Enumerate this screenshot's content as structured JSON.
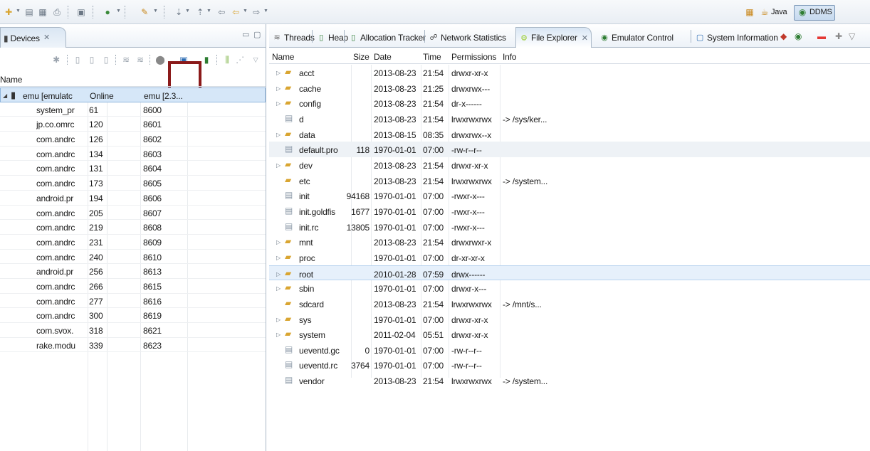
{
  "toolbar": {
    "icons": [
      "new-icon",
      "save-icon",
      "save-all-icon",
      "print-icon",
      "terminal-icon",
      "run-icon",
      "wand-icon",
      "next-annotation-icon",
      "prev-annotation-icon",
      "back-icon",
      "forward-icon",
      "history-icon"
    ],
    "perspectives": [
      {
        "name": "open-perspective-icon",
        "label": ""
      },
      {
        "name": "java-perspective",
        "label": "Java"
      },
      {
        "name": "ddms-perspective",
        "label": "DDMS"
      }
    ]
  },
  "devices": {
    "tab_label": "Devices",
    "tab_close": "✕",
    "column_name": "Name",
    "rows": [
      {
        "name": "emu [emulatc",
        "pid": "Online",
        "port": "emu [2.3...",
        "expanded": true,
        "device": true
      },
      {
        "name": "system_pr",
        "pid": "61",
        "port": "8600"
      },
      {
        "name": "jp.co.omrc",
        "pid": "120",
        "port": "8601"
      },
      {
        "name": "com.andrc",
        "pid": "126",
        "port": "8602"
      },
      {
        "name": "com.andrc",
        "pid": "134",
        "port": "8603"
      },
      {
        "name": "com.andrc",
        "pid": "131",
        "port": "8604"
      },
      {
        "name": "com.andrc",
        "pid": "173",
        "port": "8605"
      },
      {
        "name": "android.pr",
        "pid": "194",
        "port": "8606"
      },
      {
        "name": "com.andrc",
        "pid": "205",
        "port": "8607"
      },
      {
        "name": "com.andrc",
        "pid": "219",
        "port": "8608"
      },
      {
        "name": "com.andrc",
        "pid": "231",
        "port": "8609"
      },
      {
        "name": "com.andrc",
        "pid": "240",
        "port": "8610"
      },
      {
        "name": "android.pr",
        "pid": "256",
        "port": "8613"
      },
      {
        "name": "com.andrc",
        "pid": "266",
        "port": "8615"
      },
      {
        "name": "com.andrc",
        "pid": "277",
        "port": "8616"
      },
      {
        "name": "com.andrc",
        "pid": "300",
        "port": "8619"
      },
      {
        "name": "com.svox.",
        "pid": "318",
        "port": "8621"
      },
      {
        "name": "rake.modu",
        "pid": "339",
        "port": "8623"
      }
    ]
  },
  "views": {
    "tabs": [
      {
        "label": "Threads",
        "icon": "threads-icon",
        "active": false
      },
      {
        "label": "Heap",
        "icon": "heap-icon",
        "active": false
      },
      {
        "label": "Allocation Tracker",
        "icon": "allocation-icon",
        "active": false
      },
      {
        "label": "Network Statistics",
        "icon": "network-icon",
        "active": false
      },
      {
        "label": "File Explorer",
        "icon": "android-icon",
        "active": true
      },
      {
        "label": "Emulator Control",
        "icon": "emulator-icon",
        "active": false
      },
      {
        "label": "System Information",
        "icon": "sysinfo-icon",
        "active": false
      }
    ]
  },
  "file_explorer": {
    "columns": {
      "name": "Name",
      "size": "Size",
      "date": "Date",
      "time": "Time",
      "permissions": "Permissions",
      "info": "Info"
    },
    "rows": [
      {
        "name": "acct",
        "folder": true,
        "expandable": true,
        "size": "",
        "date": "2013-08-23",
        "time": "21:54",
        "perm": "drwxr-xr-x",
        "info": ""
      },
      {
        "name": "cache",
        "folder": true,
        "expandable": true,
        "size": "",
        "date": "2013-08-23",
        "time": "21:25",
        "perm": "drwxrwx---",
        "info": ""
      },
      {
        "name": "config",
        "folder": true,
        "expandable": true,
        "size": "",
        "date": "2013-08-23",
        "time": "21:54",
        "perm": "dr-x------",
        "info": ""
      },
      {
        "name": "d",
        "folder": false,
        "expandable": false,
        "size": "",
        "date": "2013-08-23",
        "time": "21:54",
        "perm": "lrwxrwxrwx",
        "info": "-> /sys/ker..."
      },
      {
        "name": "data",
        "folder": true,
        "expandable": true,
        "size": "",
        "date": "2013-08-15",
        "time": "08:35",
        "perm": "drwxrwx--x",
        "info": ""
      },
      {
        "name": "default.pro",
        "folder": false,
        "expandable": false,
        "size": "118",
        "date": "1970-01-01",
        "time": "07:00",
        "perm": "-rw-r--r--",
        "info": ""
      },
      {
        "name": "dev",
        "folder": true,
        "expandable": true,
        "size": "",
        "date": "2013-08-23",
        "time": "21:54",
        "perm": "drwxr-xr-x",
        "info": ""
      },
      {
        "name": "etc",
        "folder": true,
        "expandable": false,
        "size": "",
        "date": "2013-08-23",
        "time": "21:54",
        "perm": "lrwxrwxrwx",
        "info": "-> /system..."
      },
      {
        "name": "init",
        "folder": false,
        "expandable": false,
        "size": "94168",
        "date": "1970-01-01",
        "time": "07:00",
        "perm": "-rwxr-x---",
        "info": ""
      },
      {
        "name": "init.goldfis",
        "folder": false,
        "expandable": false,
        "size": "1677",
        "date": "1970-01-01",
        "time": "07:00",
        "perm": "-rwxr-x---",
        "info": ""
      },
      {
        "name": "init.rc",
        "folder": false,
        "expandable": false,
        "size": "13805",
        "date": "1970-01-01",
        "time": "07:00",
        "perm": "-rwxr-x---",
        "info": ""
      },
      {
        "name": "mnt",
        "folder": true,
        "expandable": true,
        "size": "",
        "date": "2013-08-23",
        "time": "21:54",
        "perm": "drwxrwxr-x",
        "info": ""
      },
      {
        "name": "proc",
        "folder": true,
        "expandable": true,
        "size": "",
        "date": "1970-01-01",
        "time": "07:00",
        "perm": "dr-xr-xr-x",
        "info": ""
      },
      {
        "name": "root",
        "folder": true,
        "expandable": true,
        "size": "",
        "date": "2010-01-28",
        "time": "07:59",
        "perm": "drwx------",
        "info": ""
      },
      {
        "name": "sbin",
        "folder": true,
        "expandable": true,
        "size": "",
        "date": "1970-01-01",
        "time": "07:00",
        "perm": "drwxr-x---",
        "info": ""
      },
      {
        "name": "sdcard",
        "folder": true,
        "expandable": false,
        "size": "",
        "date": "2013-08-23",
        "time": "21:54",
        "perm": "lrwxrwxrwx",
        "info": "-> /mnt/s..."
      },
      {
        "name": "sys",
        "folder": true,
        "expandable": true,
        "size": "",
        "date": "1970-01-01",
        "time": "07:00",
        "perm": "drwxr-xr-x",
        "info": ""
      },
      {
        "name": "system",
        "folder": true,
        "expandable": true,
        "size": "",
        "date": "2011-02-04",
        "time": "05:51",
        "perm": "drwxr-xr-x",
        "info": ""
      },
      {
        "name": "ueventd.gc",
        "folder": false,
        "expandable": false,
        "size": "0",
        "date": "1970-01-01",
        "time": "07:00",
        "perm": "-rw-r--r--",
        "info": ""
      },
      {
        "name": "ueventd.rc",
        "folder": false,
        "expandable": false,
        "size": "3764",
        "date": "1970-01-01",
        "time": "07:00",
        "perm": "-rw-r--r--",
        "info": ""
      },
      {
        "name": "vendor",
        "folder": false,
        "expandable": false,
        "size": "",
        "date": "2013-08-23",
        "time": "21:54",
        "perm": "lrwxrwxrwx",
        "info": "-> /system..."
      }
    ],
    "selected_row": "root",
    "alt_row": "default.pro"
  },
  "colors": {
    "accent": "#8b1a1a",
    "selection": "#d6e7f8",
    "folder": "#d9a531"
  }
}
